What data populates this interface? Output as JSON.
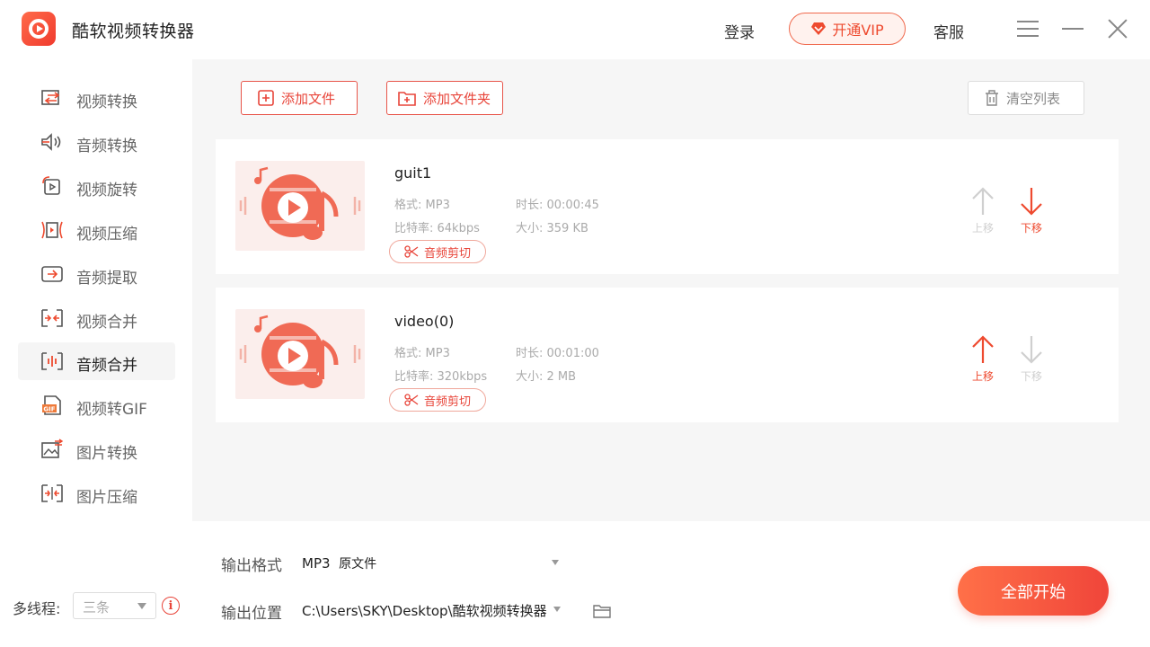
{
  "app": {
    "title": "酷软视频转换器",
    "login": "登录",
    "vip": "开通VIP",
    "support": "客服"
  },
  "sidebar": {
    "items": [
      {
        "label": "视频转换",
        "icon": "video-convert-icon"
      },
      {
        "label": "音频转换",
        "icon": "audio-convert-icon"
      },
      {
        "label": "视频旋转",
        "icon": "video-rotate-icon"
      },
      {
        "label": "视频压缩",
        "icon": "video-compress-icon"
      },
      {
        "label": "音频提取",
        "icon": "audio-extract-icon"
      },
      {
        "label": "视频合并",
        "icon": "video-merge-icon"
      },
      {
        "label": "音频合并",
        "icon": "audio-merge-icon",
        "active": true
      },
      {
        "label": "视频转GIF",
        "icon": "gif-icon"
      },
      {
        "label": "图片转换",
        "icon": "image-convert-icon"
      },
      {
        "label": "图片压缩",
        "icon": "image-compress-icon"
      }
    ],
    "threads_label": "多线程:",
    "threads_value": "三条"
  },
  "toolbar": {
    "add_file": "添加文件",
    "add_folder": "添加文件夹",
    "clear_list": "清空列表"
  },
  "files": [
    {
      "name": "guit1",
      "format": "格式: MP3",
      "duration": "时长: 00:00:45",
      "bitrate": "比特率: 64kbps",
      "size": "大小: 359 KB",
      "cut_label": "音频剪切",
      "up_label": "上移",
      "down_label": "下移",
      "up_enabled": false,
      "down_enabled": true
    },
    {
      "name": "video(0)",
      "format": "格式: MP3",
      "duration": "时长: 00:01:00",
      "bitrate": "比特率: 320kbps",
      "size": "大小: 2 MB",
      "cut_label": "音频剪切",
      "up_label": "上移",
      "down_label": "下移",
      "up_enabled": true,
      "down_enabled": false
    }
  ],
  "output": {
    "format_label": "输出格式",
    "format_value": "MP3",
    "format_quality": "原文件",
    "location_label": "输出位置",
    "location_value": "C:\\Users\\SKY\\Desktop\\酷软视频转换器"
  },
  "start_button": "全部开始",
  "colors": {
    "accent": "#ee4a2f",
    "accent_light": "#fff2ee",
    "disabled": "#cfcfcf"
  }
}
